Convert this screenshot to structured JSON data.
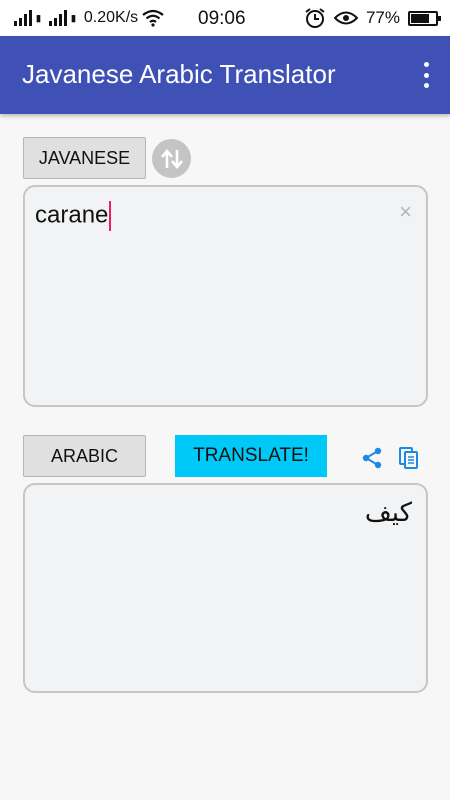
{
  "status_bar": {
    "net_speed": "0.20K/s",
    "time": "09:06",
    "battery": "77%",
    "battery_level": 0.77
  },
  "app_bar": {
    "title": "Javanese Arabic Translator"
  },
  "source": {
    "language": "JAVANESE",
    "text": "carane",
    "clear_glyph": "×"
  },
  "target": {
    "language": "ARABIC",
    "text": "كيف"
  },
  "translate_label": "TRANSLATE!",
  "colors": {
    "primary": "#3f51b5",
    "translate": "#00c9f7",
    "caret": "#e91e63",
    "icon_blue": "#1e88e5"
  },
  "icons": [
    "signal-icon",
    "wifi-icon",
    "alarm-icon",
    "eye-icon",
    "battery-icon",
    "more-vert-icon",
    "swap-icon",
    "share-icon",
    "copy-icon"
  ]
}
